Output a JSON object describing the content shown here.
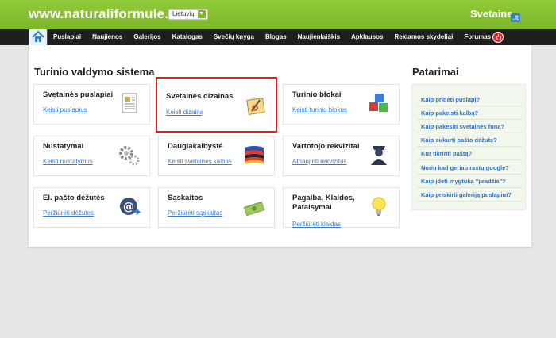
{
  "header": {
    "site_url": "www.naturaliformule.lt",
    "language": "Lietuvių",
    "brand": "Svetaine",
    "brand_badge": ".lt"
  },
  "nav": {
    "items": [
      "Puslapiai",
      "Naujienos",
      "Galerijos",
      "Katalogas",
      "Svečių knyga",
      "Blogas",
      "Naujienlaiškis",
      "Apklausos",
      "Reklamos skydeliai",
      "Forumas"
    ]
  },
  "main": {
    "title": "Turinio valdymo sistema",
    "cards": [
      {
        "title": "Svetainės puslapiai",
        "link": "Keisti puslapius",
        "icon": "pages-icon"
      },
      {
        "title": "Svetainės dizainas",
        "link": "Keisti dizainą",
        "icon": "design-icon"
      },
      {
        "title": "Turinio blokai",
        "link": "Keisti turinio blokus",
        "icon": "blocks-icon"
      },
      {
        "title": "Nustatymai",
        "link": "Keisti nustatymus",
        "icon": "gears-icon"
      },
      {
        "title": "Daugiakalbystė",
        "link": "Keisti svetainės kalbas",
        "icon": "flags-icon"
      },
      {
        "title": "Vartotojo rekvizitai",
        "link": "Atnaujinti rekvizitus",
        "icon": "user-icon"
      },
      {
        "title": "El. pašto dėžutės",
        "link": "Peržiūrėti dėžutes",
        "icon": "email-icon"
      },
      {
        "title": "Sąskaitos",
        "link": "Peržiūrėti sąskaitas",
        "icon": "money-icon"
      },
      {
        "title": "Pagalba, Klaidos, Pataisymai",
        "link": "Peržiūrėti klaidas",
        "icon": "bulb-icon"
      }
    ]
  },
  "tips": {
    "title": "Patarimai",
    "items": [
      "Kaip pridėti puslapį?",
      "Kaip pakeisti kalbą?",
      "Kaip pakesiti svetainės foną?",
      "Kaip sukurti pašto dėžutę?",
      "Kur tikrinti paštą?",
      "Noriu kad geriau rastų google?",
      "Kaip įdėti mygtuką \"pradžia\"?",
      "Kaip priskirti galeriją puslapiui?"
    ]
  },
  "colors": {
    "header_green": "#8bc433",
    "nav_dark": "#1f1f1f",
    "link_blue": "#3b79c9",
    "highlight_red": "#e0201a"
  }
}
